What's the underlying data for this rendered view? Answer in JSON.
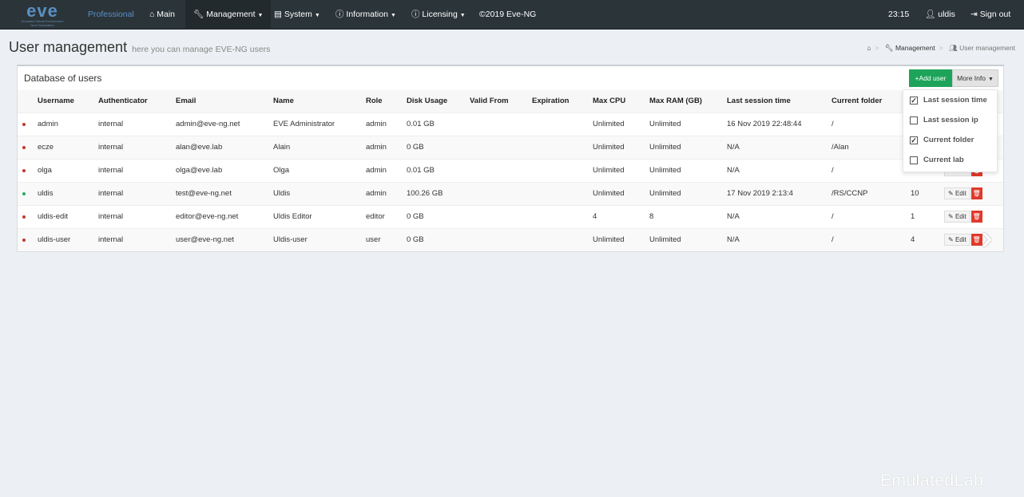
{
  "nav": {
    "logo": "eve",
    "logo_sub": "Emulated Virtual Environment Next Generation",
    "edition": "Professional",
    "items": [
      "Main",
      "Management",
      "System",
      "Information",
      "Licensing"
    ],
    "copyright": "©2019 Eve-NG",
    "time": "23:15",
    "user": "uldis",
    "signout": "Sign out"
  },
  "page": {
    "title": "User management",
    "subtitle": "here you can manage EVE-NG users"
  },
  "breadcrumb": {
    "home": "⌂",
    "management": "Management",
    "current": "User management"
  },
  "panel": {
    "title": "Database of users",
    "add_user": "+Add user",
    "more_info": "More Info"
  },
  "columns": [
    "Username",
    "Authenticator",
    "Email",
    "Name",
    "Role",
    "Disk Usage",
    "Valid From",
    "Expiration",
    "Max CPU",
    "Max RAM (GB)",
    "Last session time",
    "Current folder"
  ],
  "edit_label": "Edit",
  "status_colors": {
    "offline": "#c0392b",
    "online": "#27ae60"
  },
  "users": [
    {
      "status": "offline",
      "username": "admin",
      "auth": "internal",
      "email": "admin@eve-ng.net",
      "name": "EVE Administrator",
      "role": "admin",
      "disk": "0.01 GB",
      "valid_from": "",
      "expiration": "",
      "cpu": "Unlimited",
      "ram": "Unlimited",
      "last_session": "16 Nov 2019 22:48:44",
      "folder": "/",
      "pod": ""
    },
    {
      "status": "offline",
      "username": "ecze",
      "auth": "internal",
      "email": "alan@eve.lab",
      "name": "Alain",
      "role": "admin",
      "disk": "0 GB",
      "valid_from": "",
      "expiration": "",
      "cpu": "Unlimited",
      "ram": "Unlimited",
      "last_session": "N/A",
      "folder": "/Alan",
      "pod": ""
    },
    {
      "status": "offline",
      "username": "olga",
      "auth": "internal",
      "email": "olga@eve.lab",
      "name": "Olga",
      "role": "admin",
      "disk": "0.01 GB",
      "valid_from": "",
      "expiration": "",
      "cpu": "Unlimited",
      "ram": "Unlimited",
      "last_session": "N/A",
      "folder": "/",
      "pod": ""
    },
    {
      "status": "online",
      "username": "uldis",
      "auth": "internal",
      "email": "test@eve-ng.net",
      "name": "Uldis",
      "role": "admin",
      "disk": "100.26 GB",
      "valid_from": "",
      "expiration": "",
      "cpu": "Unlimited",
      "ram": "Unlimited",
      "last_session": "17 Nov 2019 2:13:4",
      "folder": "/RS/CCNP",
      "pod": "10"
    },
    {
      "status": "offline",
      "username": "uldis-edit",
      "auth": "internal",
      "email": "editor@eve-ng.net",
      "name": "Uldis Editor",
      "role": "editor",
      "disk": "0 GB",
      "valid_from": "",
      "expiration": "",
      "cpu": "4",
      "ram": "8",
      "last_session": "N/A",
      "folder": "/",
      "pod": "1"
    },
    {
      "status": "offline",
      "username": "uldis-user",
      "auth": "internal",
      "email": "user@eve-ng.net",
      "name": "Uldis-user",
      "role": "user",
      "disk": "0 GB",
      "valid_from": "",
      "expiration": "",
      "cpu": "Unlimited",
      "ram": "Unlimited",
      "last_session": "N/A",
      "folder": "/",
      "pod": "4"
    }
  ],
  "more_info_options": [
    {
      "label": "Last session time",
      "checked": true
    },
    {
      "label": "Last session ip",
      "checked": false
    },
    {
      "label": "Current folder",
      "checked": true
    },
    {
      "label": "Current lab",
      "checked": false
    }
  ],
  "watermark": "EmulatedLab"
}
